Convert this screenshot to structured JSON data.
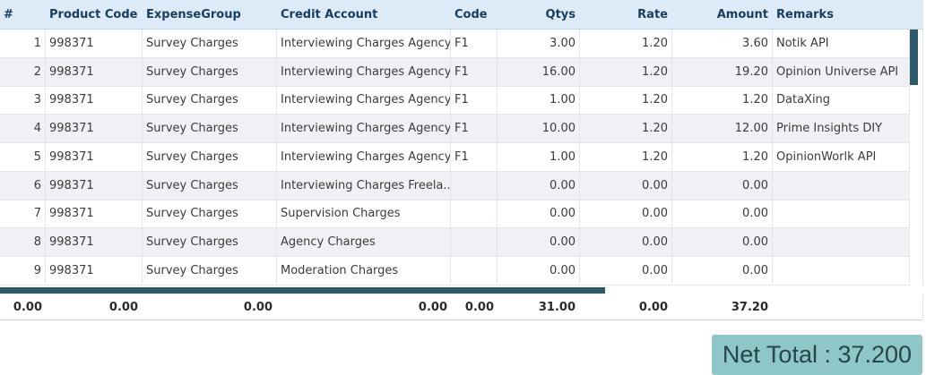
{
  "headers": {
    "num": "#",
    "product_code": "Product Code",
    "expense_group": "ExpenseGroup",
    "credit_account": "Credit Account",
    "code": "Code",
    "qtys": "Qtys",
    "rate": "Rate",
    "amount": "Amount",
    "remarks": "Remarks"
  },
  "rows": [
    {
      "num": "1",
      "product_code": "998371",
      "expense_group": "Survey Charges",
      "credit_account": "Interviewing Charges Agency",
      "code": "F1",
      "qtys": "3.00",
      "rate": "1.20",
      "amount": "3.60",
      "remarks": "Notik API"
    },
    {
      "num": "2",
      "product_code": "998371",
      "expense_group": "Survey Charges",
      "credit_account": "Interviewing Charges Agency",
      "code": "F1",
      "qtys": "16.00",
      "rate": "1.20",
      "amount": "19.20",
      "remarks": "Opinion Universe API"
    },
    {
      "num": "3",
      "product_code": "998371",
      "expense_group": "Survey Charges",
      "credit_account": "Interviewing Charges Agency",
      "code": "F1",
      "qtys": "1.00",
      "rate": "1.20",
      "amount": "1.20",
      "remarks": "DataXing"
    },
    {
      "num": "4",
      "product_code": "998371",
      "expense_group": "Survey Charges",
      "credit_account": "Interviewing Charges Agency",
      "code": "F1",
      "qtys": "10.00",
      "rate": "1.20",
      "amount": "12.00",
      "remarks": "Prime Insights DIY"
    },
    {
      "num": "5",
      "product_code": "998371",
      "expense_group": "Survey Charges",
      "credit_account": "Interviewing Charges Agency",
      "code": "F1",
      "qtys": "1.00",
      "rate": "1.20",
      "amount": "1.20",
      "remarks": "OpinionWorlk API"
    },
    {
      "num": "6",
      "product_code": "998371",
      "expense_group": "Survey Charges",
      "credit_account": "Interviewing Charges Freela...",
      "code": "",
      "qtys": "0.00",
      "rate": "0.00",
      "amount": "0.00",
      "remarks": ""
    },
    {
      "num": "7",
      "product_code": "998371",
      "expense_group": "Survey Charges",
      "credit_account": "Supervision Charges",
      "code": "",
      "qtys": "0.00",
      "rate": "0.00",
      "amount": "0.00",
      "remarks": ""
    },
    {
      "num": "8",
      "product_code": "998371",
      "expense_group": "Survey Charges",
      "credit_account": "Agency Charges",
      "code": "",
      "qtys": "0.00",
      "rate": "0.00",
      "amount": "0.00",
      "remarks": ""
    },
    {
      "num": "9",
      "product_code": "998371",
      "expense_group": "Survey Charges",
      "credit_account": "Moderation Charges",
      "code": "",
      "qtys": "0.00",
      "rate": "0.00",
      "amount": "0.00",
      "remarks": ""
    }
  ],
  "footer": {
    "col1": "0.00",
    "col2": "0.00",
    "col3": "0.00",
    "col4": "0.00",
    "col5": "0.00",
    "qtys": "31.00",
    "rate": "0.00",
    "amount": "37.20"
  },
  "net_total": {
    "label": "Net Total : ",
    "value": "37.200"
  }
}
